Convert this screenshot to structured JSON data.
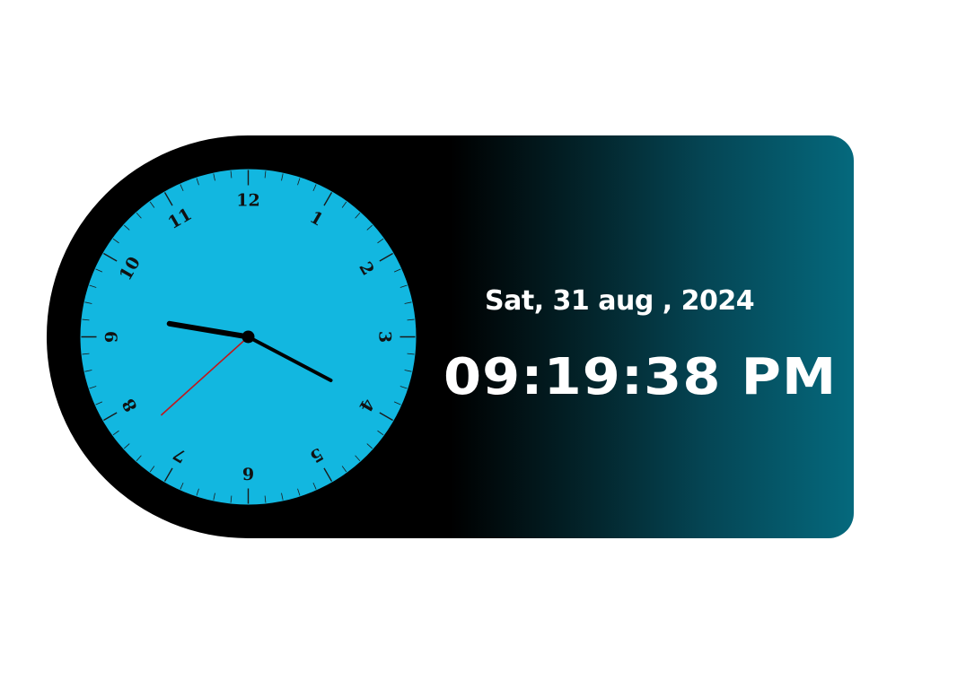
{
  "clock": {
    "date": "Sat, 31 aug , 2024",
    "time": "09:19:38 PM",
    "hour": 9,
    "minute": 19,
    "second": 38,
    "numerals": [
      "12",
      "1",
      "2",
      "3",
      "4",
      "5",
      "6",
      "7",
      "8",
      "9",
      "10",
      "11"
    ],
    "colors": {
      "face": "#12b7e0",
      "hands": "#000000",
      "second_hand": "#c0181c",
      "bezel": "#000000",
      "gradient_end": "#05697d",
      "text": "#ffffff"
    }
  }
}
